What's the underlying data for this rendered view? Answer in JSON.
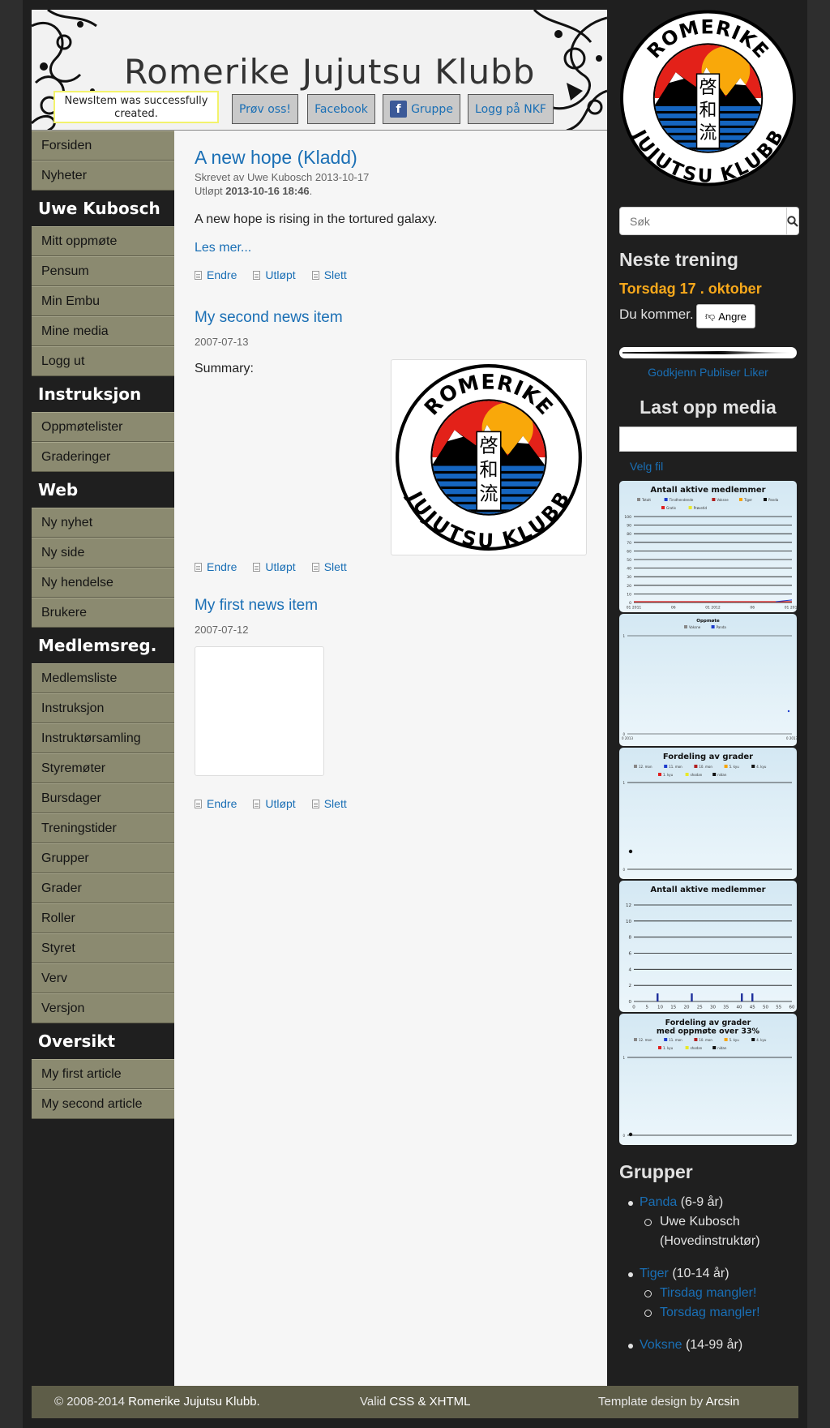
{
  "header": {
    "site_title": "Romerike Jujutsu Klubb",
    "flash": "NewsItem was successfully created.",
    "buttons": {
      "try": "Prøv oss!",
      "facebook": "Facebook",
      "group": "Gruppe",
      "login_nkf": "Logg på NKF"
    }
  },
  "logo": {
    "top_text": "ROMERIKE",
    "bottom_text": "JUJUTSU KLUBB",
    "kanji": [
      "啓",
      "和",
      "流"
    ],
    "colors": {
      "red": "#e32119",
      "sun": "#f9a80a",
      "blue": "#1565c0",
      "black": "#000000"
    }
  },
  "nav": {
    "main": [
      "Forsiden",
      "Nyheter"
    ],
    "user_heading": "Uwe Kubosch",
    "user_items": [
      "Mitt oppmøte",
      "Pensum",
      "Min Embu",
      "Mine media",
      "Logg ut"
    ],
    "instruction_heading": "Instruksjon",
    "instruction_items": [
      "Oppmøtelister",
      "Graderinger"
    ],
    "web_heading": "Web",
    "web_items": [
      "Ny nyhet",
      "Ny side",
      "Ny hendelse",
      "Brukere"
    ],
    "members_heading": "Medlemsreg.",
    "members_items": [
      "Medlemsliste",
      "Instruksjon",
      "Instruktørsamling",
      "Styremøter",
      "Bursdager",
      "Treningstider",
      "Grupper",
      "Grader",
      "Roller",
      "Styret",
      "Verv",
      "Versjon"
    ],
    "overview_heading": "Oversikt",
    "overview_items": [
      "My first article",
      "My second article"
    ]
  },
  "posts": [
    {
      "title": "A new hope (Kladd)",
      "byline": "Skrevet av Uwe Kubosch 2013-10-17",
      "expired_label": "Utløpt",
      "expired_date": "2013-10-16 18:46",
      "expired_suffix": ".",
      "body": "A new hope is rising in the tortured galaxy.",
      "read_more": "Les mer..."
    },
    {
      "title": "My second news item",
      "date": "2007-07-13",
      "summary": "Summary:"
    },
    {
      "title": "My first news item",
      "date": "2007-07-12"
    }
  ],
  "actions": {
    "edit": "Endre",
    "expire": "Utløpt",
    "delete": "Slett"
  },
  "sidebar": {
    "search_placeholder": "Søk",
    "next_training_heading": "Neste trening",
    "next_training_date": "Torsdag 17 . oktober",
    "attending_text": "Du kommer.",
    "undo_button": "Angre",
    "approve_links": "Godkjenn Publiser Liker",
    "upload_heading": "Last opp media",
    "choose_file": "Velg fil",
    "groups_heading": "Grupper",
    "groups": [
      {
        "name": "Panda",
        "ages": "(6-9 år)",
        "members": [
          "Uwe Kubosch (Hovedinstruktør)"
        ]
      },
      {
        "name": "Tiger",
        "ages": "(10-14 år)",
        "missing": [
          "Tirsdag mangler!",
          "Torsdag mangler!"
        ]
      },
      {
        "name": "Voksne",
        "ages": "(14-99 år)"
      }
    ],
    "accent_color": "#f6a81b"
  },
  "chart_data": [
    {
      "type": "line",
      "title": "Antall aktive medlemmer",
      "legend": [
        "Totalt",
        "Tirsdhendende",
        "Voksne",
        "Tiger",
        "Panda",
        "Gratis",
        "Prøvetid"
      ],
      "y_ticks": [
        0,
        10,
        20,
        30,
        40,
        50,
        60,
        70,
        80,
        90,
        100
      ],
      "x_ticks": [
        "01 2011",
        "06",
        "01 2012",
        "06",
        "01 2013"
      ],
      "ylim": [
        0,
        100
      ]
    },
    {
      "type": "scatter",
      "title": "Oppmøte",
      "legend": [
        "Voksne",
        "Panda"
      ],
      "y_ticks": [
        0,
        1
      ],
      "x_ticks": [
        "0 2013",
        "0 2013"
      ],
      "ylim": [
        0,
        1
      ]
    },
    {
      "type": "line",
      "title": "Fordeling av grader",
      "legend": [
        "12. mon",
        "11. mon",
        "10. mon",
        "5. kyu",
        "4. kyu",
        "1. kyu",
        "shodan",
        "nidan"
      ],
      "y_ticks": [
        0,
        1
      ],
      "ylim": [
        0,
        1
      ]
    },
    {
      "type": "bar",
      "title": "Antall aktive medlemmer",
      "x_ticks": [
        0,
        5,
        10,
        15,
        20,
        25,
        30,
        35,
        40,
        45,
        50,
        55,
        60
      ],
      "y_ticks": [
        0,
        2,
        4,
        6,
        8,
        10,
        12
      ],
      "bars_x": [
        9,
        22,
        41,
        45
      ],
      "bars_y": [
        1,
        1,
        1,
        1
      ],
      "xlim": [
        0,
        60
      ],
      "ylim": [
        0,
        12
      ]
    },
    {
      "type": "line",
      "title": "Fordeling av grader med oppmøte over 33%",
      "legend": [
        "12. mon",
        "11. mon",
        "10. mon",
        "5. kyu",
        "4. kyu",
        "1. kyu",
        "shodan",
        "nidan"
      ],
      "y_ticks": [
        0,
        1
      ],
      "ylim": [
        0,
        1
      ]
    }
  ],
  "footer": {
    "copyright_prefix": "© 2008-2014",
    "club": "Romerike Jujutsu Klubb.",
    "valid_prefix": "Valid",
    "css": "CSS",
    "amp": "&",
    "xhtml": "XHTML",
    "design_prefix": "Template design by",
    "designer": "Arcsin"
  }
}
